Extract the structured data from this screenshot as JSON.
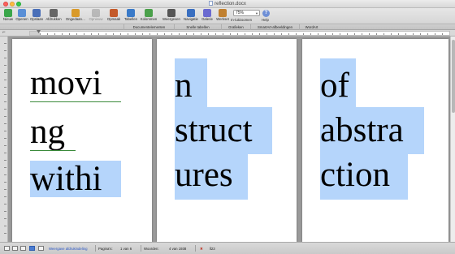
{
  "window": {
    "title": "reflection.docx"
  },
  "toolbar": {
    "buttons": [
      {
        "label": "Nieuw",
        "icon": "new-document-icon",
        "color": "#3aa64a"
      },
      {
        "label": "Openen",
        "icon": "open-folder-icon",
        "color": "#5a8fd6"
      },
      {
        "label": "Opslaan",
        "icon": "save-icon",
        "color": "#4a6fb8"
      },
      {
        "label": "Afdrukken",
        "icon": "print-icon",
        "color": "#666666"
      },
      {
        "label": "Ongedaan…",
        "icon": "undo-icon",
        "color": "#d99a2a"
      },
      {
        "label": "Opnieuw",
        "icon": "redo-icon",
        "color": "#888888"
      },
      {
        "label": "Opmaak",
        "icon": "format-brush-icon",
        "color": "#c45a2a"
      },
      {
        "label": "Tabellen",
        "icon": "table-icon",
        "color": "#3a7ac8"
      },
      {
        "label": "Kolommen",
        "icon": "columns-icon",
        "color": "#4aa04a"
      },
      {
        "label": "Weergeven",
        "icon": "pilcrow-icon",
        "color": "#555555"
      },
      {
        "label": "Navigatie",
        "icon": "navigation-icon",
        "color": "#3a6fc0"
      },
      {
        "label": "Galerie",
        "icon": "gallery-icon",
        "color": "#6a6ad0"
      },
      {
        "label": "Werkset",
        "icon": "toolbox-icon",
        "color": "#c08030"
      }
    ],
    "zoom": {
      "value": "75%",
      "label": "In-/uitzoomen"
    },
    "help_label": "Help"
  },
  "ribbon": {
    "tabs": [
      "Documentelementen",
      "Snelle tabellen",
      "Grafieken",
      "SmartArt-afbeeldingen",
      "WordArt"
    ]
  },
  "pages": [
    {
      "lines": [
        "movi",
        "ng",
        "withi"
      ]
    },
    {
      "lines": [
        "n",
        "struct",
        "ures"
      ]
    },
    {
      "lines": [
        "of",
        "abstra",
        "ction"
      ]
    }
  ],
  "colors": {
    "selection": "#b5d5fb",
    "spelling": "#3a8a3a"
  },
  "statusbar": {
    "view_label": "Weergave afdrukindeling",
    "pages_label": "Pagina's:",
    "pages_value": "1 van 6",
    "words_label": "Woorden:",
    "words_value": "4 van 1938",
    "language": "ll23"
  }
}
